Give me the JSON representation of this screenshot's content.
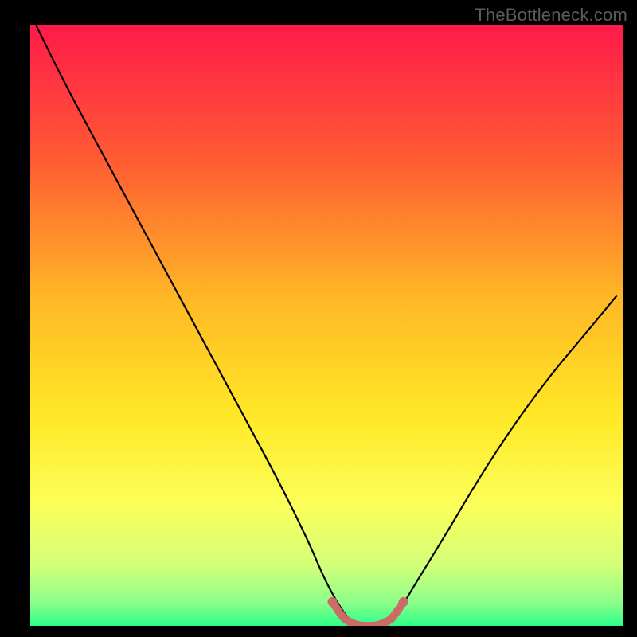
{
  "watermark": "TheBottleneck.com",
  "chart_data": {
    "type": "line",
    "title": "",
    "xlabel": "",
    "ylabel": "",
    "xlim": [
      0,
      100
    ],
    "ylim": [
      0,
      100
    ],
    "background_gradient": {
      "stops": [
        {
          "pos": 0.0,
          "color": "#ff1a4a"
        },
        {
          "pos": 0.22,
          "color": "#ff5a33"
        },
        {
          "pos": 0.45,
          "color": "#ffb626"
        },
        {
          "pos": 0.65,
          "color": "#ffe826"
        },
        {
          "pos": 0.8,
          "color": "#fbff5a"
        },
        {
          "pos": 0.9,
          "color": "#d2ff7a"
        },
        {
          "pos": 0.96,
          "color": "#8dff8a"
        },
        {
          "pos": 1.0,
          "color": "#2cff88"
        }
      ]
    },
    "series": [
      {
        "name": "bottleneck-curve",
        "color": "#000000",
        "x": [
          1,
          6,
          12,
          18,
          24,
          30,
          36,
          42,
          47,
          50,
          53,
          55,
          58,
          60,
          62,
          65,
          70,
          76,
          82,
          88,
          94,
          99
        ],
        "y": [
          100,
          90,
          79,
          68,
          57,
          46,
          35,
          24,
          14,
          7,
          2,
          0,
          0,
          0,
          2,
          7,
          15,
          25,
          34,
          42,
          49,
          55
        ]
      },
      {
        "name": "optimal-band",
        "color": "#cc6a66",
        "style": "thick-dotted",
        "x": [
          51,
          52,
          53,
          54,
          55,
          56,
          57,
          58,
          59,
          60,
          61,
          62,
          63
        ],
        "y": [
          4,
          2.5,
          1.2,
          0.6,
          0.2,
          0,
          0,
          0,
          0.2,
          0.6,
          1.2,
          2.5,
          4
        ]
      }
    ]
  }
}
